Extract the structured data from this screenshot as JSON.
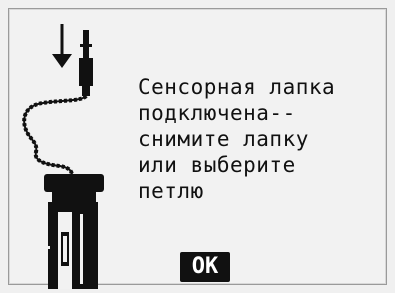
{
  "message": {
    "lines": [
      "Сенсорная лапка",
      "подключена--",
      "снимите лапку",
      "или выберите",
      "петлю"
    ]
  },
  "buttons": {
    "ok_label": "OK"
  },
  "illustration": {
    "icon": "sensor-presser-foot-icon"
  },
  "colors": {
    "background": "#f2f2f2",
    "text": "#111111",
    "button_bg": "#111111",
    "button_text": "#ffffff"
  }
}
